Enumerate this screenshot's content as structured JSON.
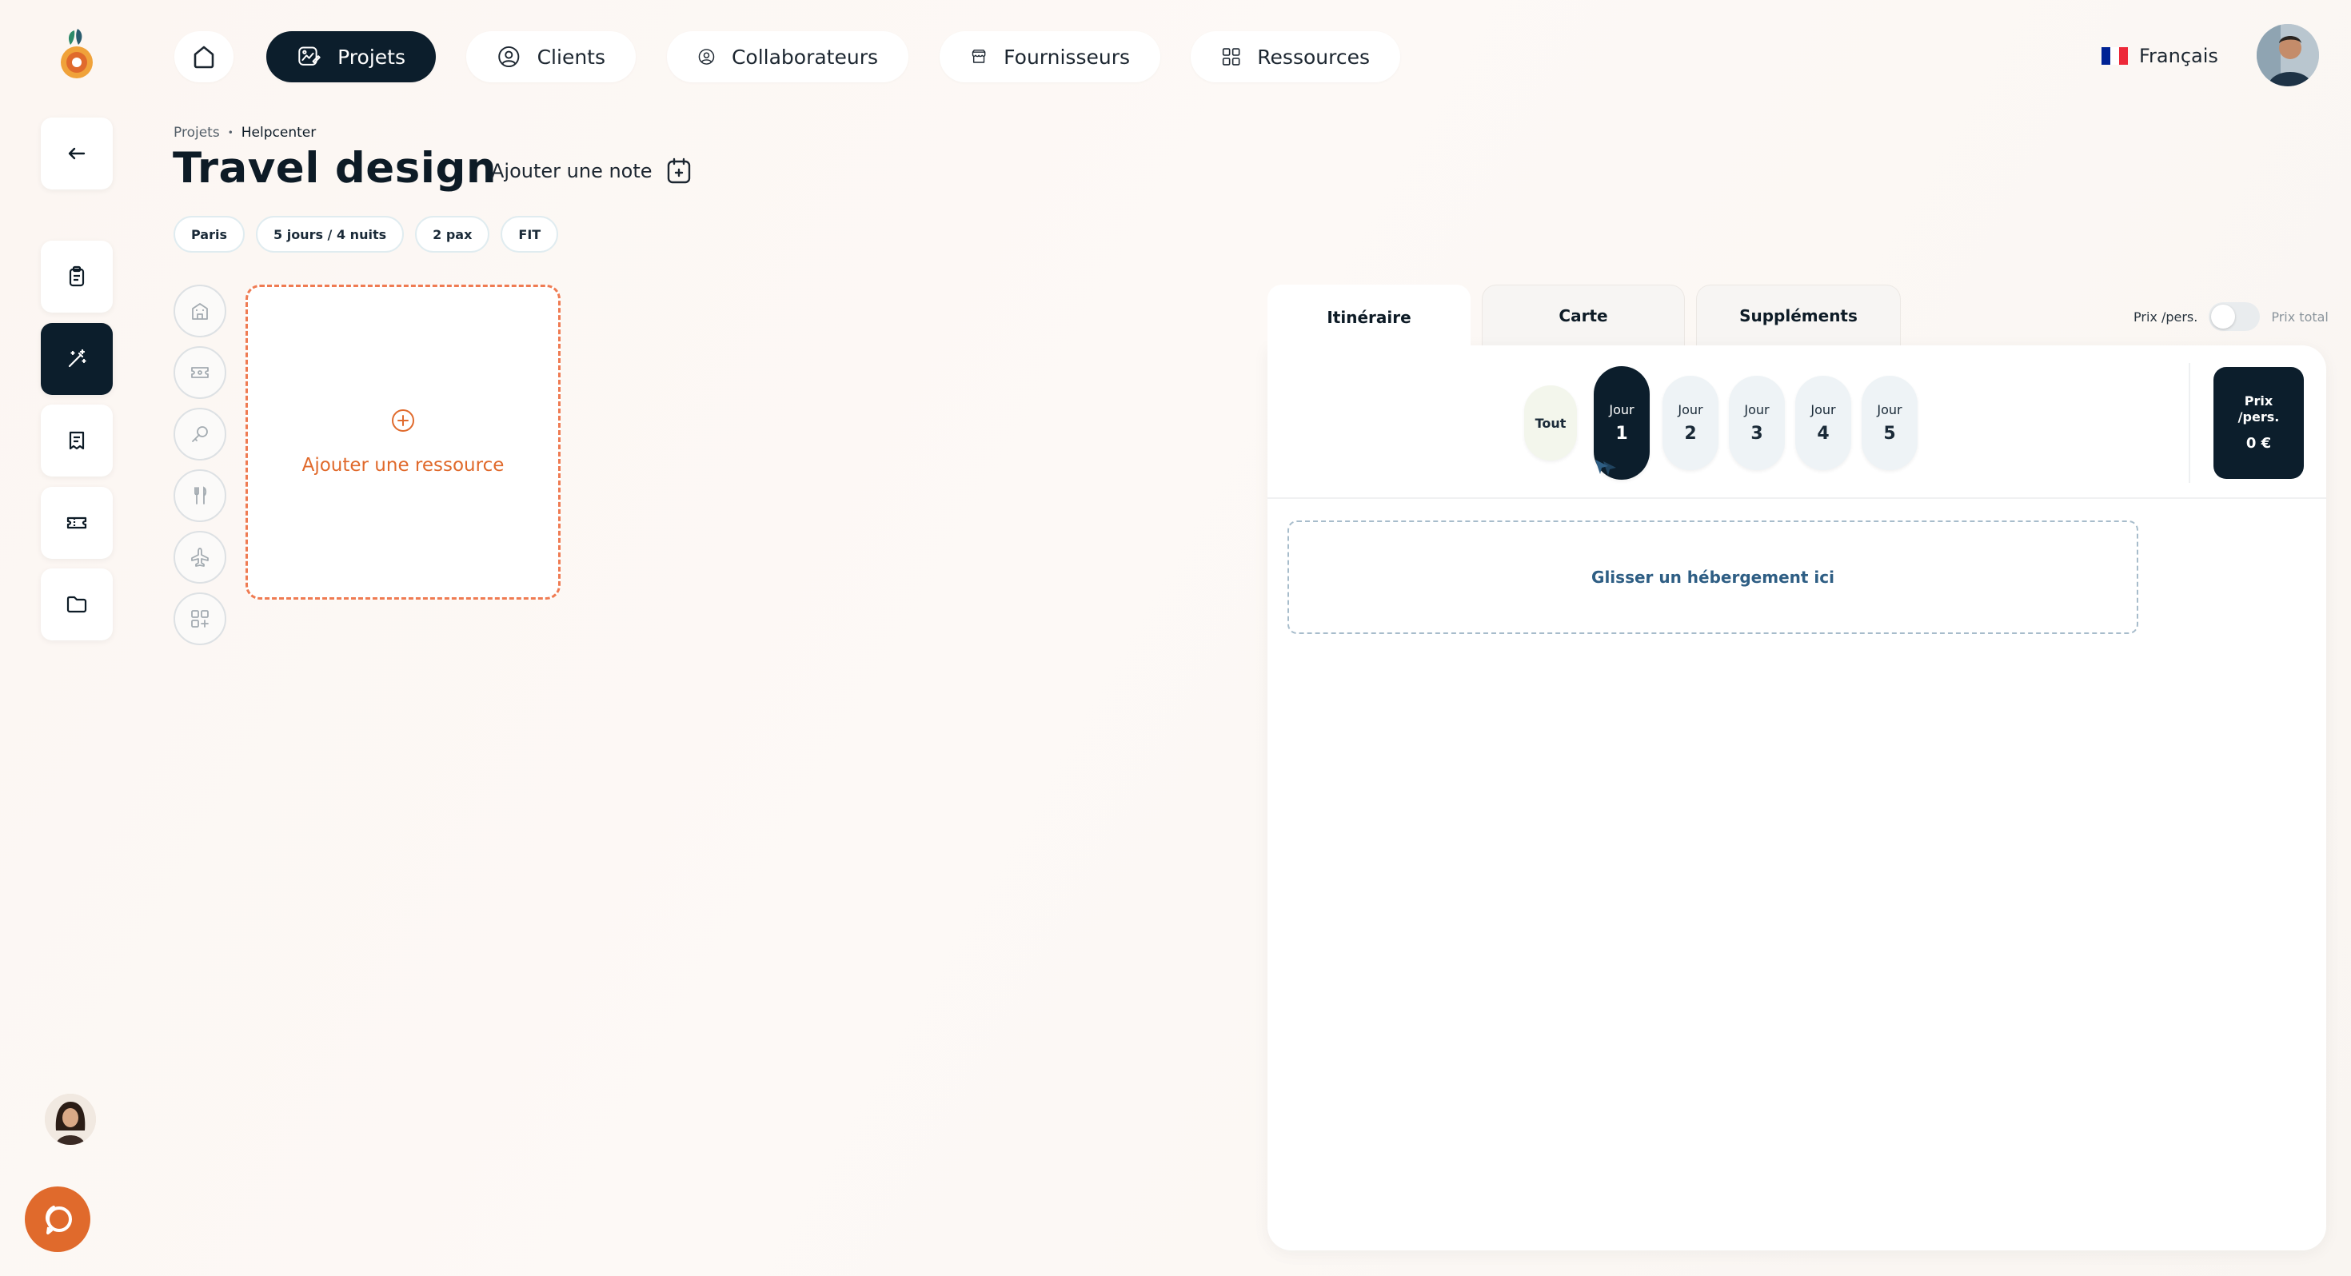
{
  "nav": {
    "home_icon": "home-icon",
    "items": [
      {
        "label": "Projets",
        "icon": "projects-icon",
        "active": true
      },
      {
        "label": "Clients",
        "icon": "user-circle-icon"
      },
      {
        "label": "Collaborateurs",
        "icon": "user-circle-icon"
      },
      {
        "label": "Fournisseurs",
        "icon": "store-icon"
      },
      {
        "label": "Ressources",
        "icon": "grid-icon"
      }
    ]
  },
  "language": {
    "label": "Français",
    "flag_colors": [
      "#002395",
      "#ffffff",
      "#ed2939"
    ]
  },
  "sidebar": {
    "items": [
      "back-arrow-icon",
      "clipboard-icon",
      "magic-wand-icon",
      "receipt-icon",
      "ticket-icon",
      "folder-icon"
    ],
    "active_index": 2
  },
  "breadcrumb": {
    "parent": "Projets",
    "separator": "•",
    "current": "Helpcenter"
  },
  "page": {
    "title": "Travel design",
    "add_note_label": "Ajouter une note",
    "chips": [
      "Paris",
      "5 jours / 4 nuits",
      "2 pax",
      "FIT"
    ]
  },
  "resource_types": [
    "building-icon",
    "ticket-icon",
    "key-icon",
    "fork-knife-icon",
    "plane-icon",
    "grid-plus-icon"
  ],
  "add_resource": {
    "label": "Ajouter une ressource"
  },
  "tabs": {
    "items": [
      "Itinéraire",
      "Carte",
      "Suppléments"
    ],
    "active_index": 0
  },
  "price_toggle": {
    "left_label": "Prix /pers.",
    "right_label": "Prix total"
  },
  "days": {
    "all_label": "Tout",
    "day_word": "Jour",
    "numbers": [
      "1",
      "2",
      "3",
      "4",
      "5"
    ],
    "active_index": 0
  },
  "price_box": {
    "line1": "Prix",
    "line2": "/pers.",
    "amount": "0 €"
  },
  "dropzone": {
    "label": "Glisser un hébergement ici"
  },
  "colors": {
    "accent": "#e06a2c",
    "dark": "#0c1e2c",
    "background": "#fcf7f3"
  }
}
